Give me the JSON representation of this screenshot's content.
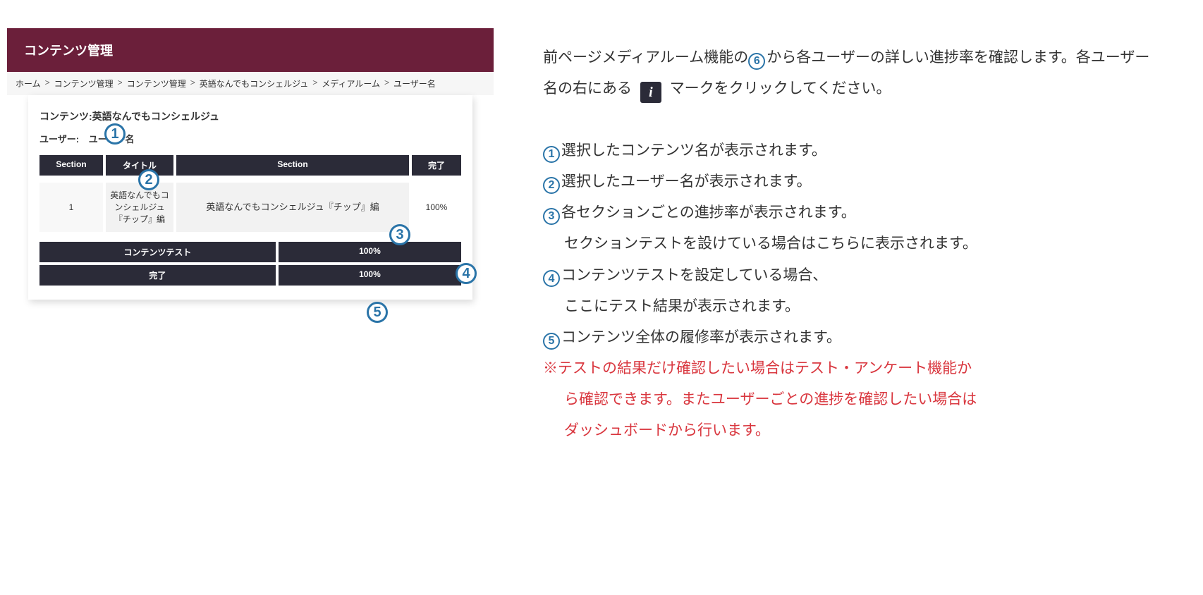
{
  "app": {
    "header_title": "コンテンツ管理"
  },
  "breadcrumb": {
    "items": [
      "ホーム",
      "コンテンツ管理",
      "コンテンツ管理",
      "英語なんでもコンシェルジュ",
      "メディアルーム",
      "ユーザー名"
    ]
  },
  "card": {
    "content_label": "コンテンツ:",
    "content_name": "英語なんでもコンシェルジュ",
    "user_label": "ユーザー:",
    "user_name": "ユーザー名",
    "headers": {
      "section1": "Section",
      "title": "タイトル",
      "section2": "Section",
      "done": "完了"
    },
    "row": {
      "section_num": "1",
      "title_text": "英語なんでもコンシェルジュ『チップ』編",
      "section_text": "英語なんでもコンシェルジュ『チップ』編",
      "done_value": "100%"
    },
    "footer": {
      "test_label": "コンテンツテスト",
      "test_value": "100%",
      "done_label": "完了",
      "done_value": "100%"
    }
  },
  "callouts": {
    "c1": "1",
    "c2": "2",
    "c3": "3",
    "c4": "4",
    "c5": "5",
    "c6": "6"
  },
  "explain": {
    "intro_part1": "前ページメディアルーム機能の",
    "intro_part2": "から各ユーザーの詳しい進捗率を確認します。各ユーザー名の右にある",
    "intro_part3": "マークをクリックしてください。",
    "info_glyph": "i",
    "line1": "選択したコンテンツ名が表示されます。",
    "line2": "選択したユーザー名が表示されます。",
    "line3a": "各セクションごとの進捗率が表示されます。",
    "line3b": "セクションテストを設けている場合はこちらに表示されます。",
    "line4a": "コンテンツテストを設定している場合、",
    "line4b": "ここにテスト結果が表示されます。",
    "line5": "コンテンツ全体の履修率が表示されます。",
    "note1": "※テストの結果だけ確認したい場合はテスト・アンケート機能か",
    "note2": "ら確認できます。またユーザーごとの進捗を確認したい場合は",
    "note3": "ダッシュボードから行います。"
  }
}
